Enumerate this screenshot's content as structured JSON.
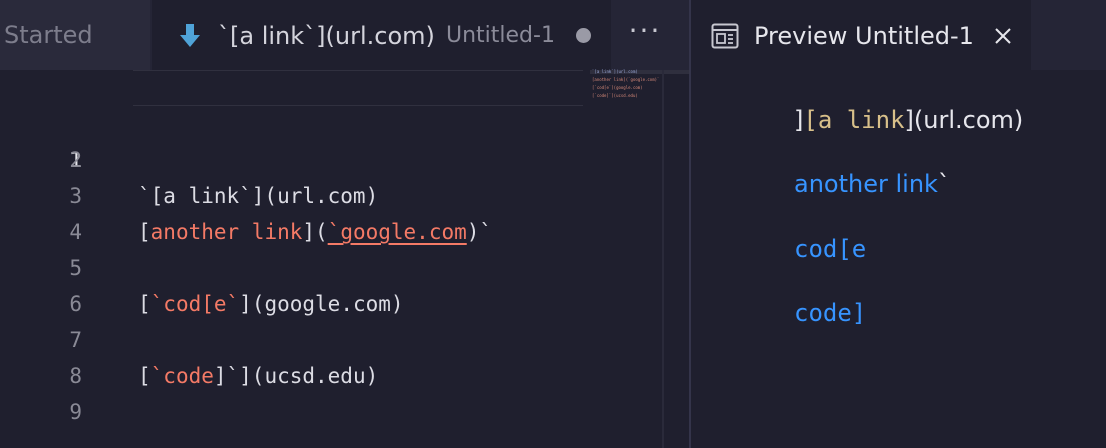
{
  "tabs": {
    "started_label": "Started",
    "active_tab_title": "`[a link`](url.com)",
    "active_tab_description": "Untitled-1",
    "more_actions": "···",
    "preview_tab_title": "Preview Untitled-1"
  },
  "editor": {
    "line_numbers": [
      "1",
      "2",
      "3",
      "4",
      "5",
      "6",
      "7",
      "8",
      "9"
    ],
    "lines": {
      "l1": {
        "text": "`[a link`](url.com)"
      },
      "l3": {
        "open": "[",
        "link": "another link",
        "mid": "](",
        "url": "`google.com",
        "close": ")`"
      },
      "l5": {
        "open": "[",
        "link": "`cod[e`",
        "rest": "](google.com)"
      },
      "l7": {
        "open": "[",
        "link": "`code",
        "rest": "]`](ucsd.edu)"
      }
    },
    "minimap_lines": [
      "`[a link`](url.com)",
      "[another link](`google.com)`",
      "[`cod[e`](google.com)",
      "[`code]`](ucsd.edu)"
    ]
  },
  "preview": {
    "line1_bracket": "]",
    "line1_code": "[a link",
    "line1_rest": "](url.com)",
    "line2_link": "another link",
    "line2_tick": "`",
    "line3_link": "cod[e",
    "line4_link": "code]"
  },
  "colors": {
    "background": "#1f1f2e",
    "link_syntax": "#f47a66",
    "preview_link": "#3794ff",
    "inline_code": "#d8c08a"
  }
}
